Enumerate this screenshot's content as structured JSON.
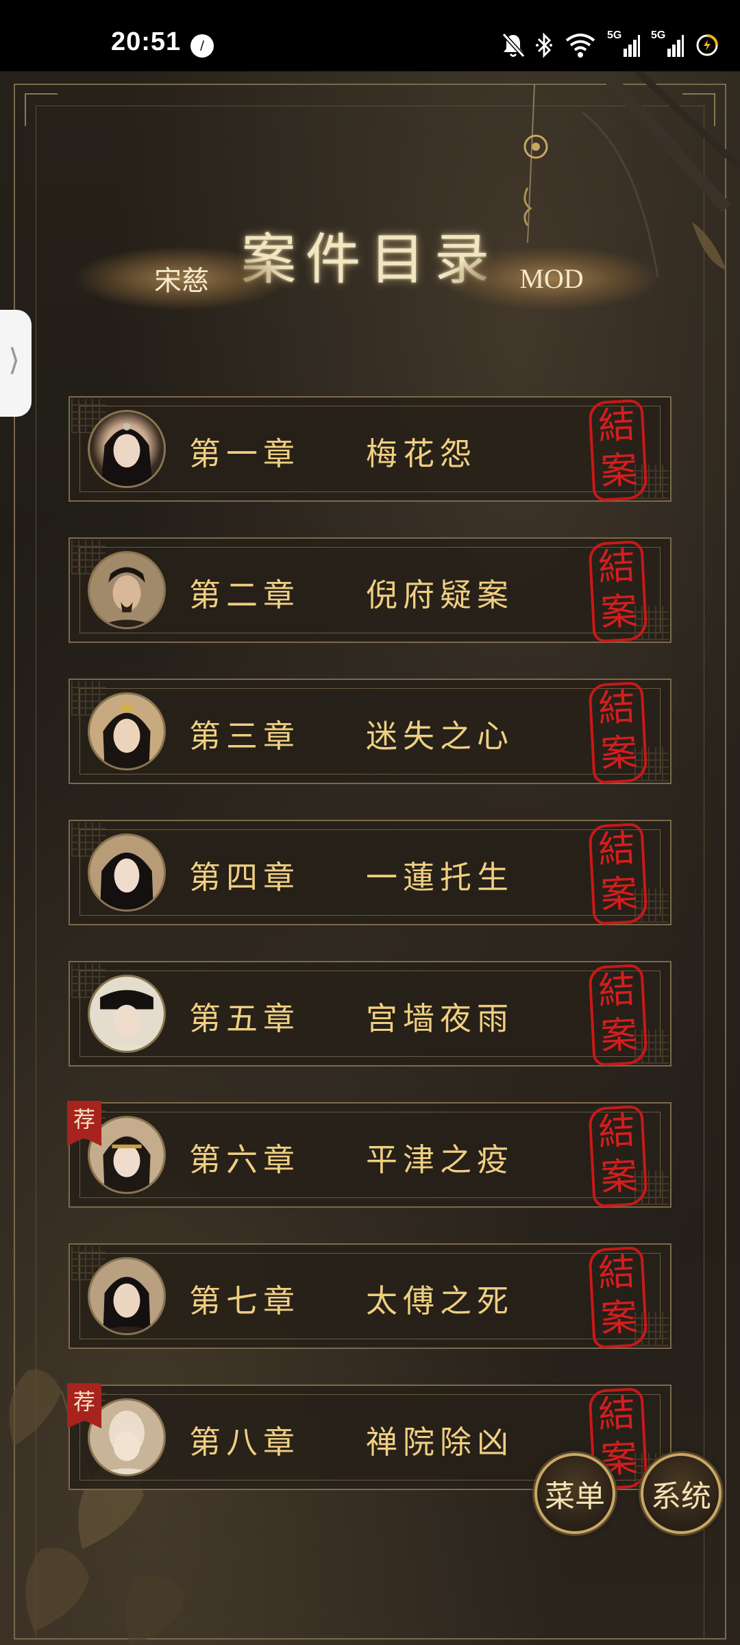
{
  "status_bar": {
    "time": "20:51",
    "app_icon_glyph": "/",
    "network_label_1": "5G",
    "network_label_2": "5G",
    "icons": [
      "mute-icon",
      "bluetooth-icon",
      "wifi-icon",
      "signal-5g-icon",
      "signal-5g-icon",
      "battery-charging-icon"
    ]
  },
  "page": {
    "title": "案件目录",
    "drawer_handle_glyph": "⟩"
  },
  "tabs": [
    {
      "label": "宋慈"
    },
    {
      "label": "MOD"
    }
  ],
  "chapters": [
    {
      "number": "第一章",
      "name": "梅花怨",
      "seal": [
        "結",
        "案"
      ],
      "recommended": false
    },
    {
      "number": "第二章",
      "name": "倪府疑案",
      "seal": [
        "結",
        "案"
      ],
      "recommended": false
    },
    {
      "number": "第三章",
      "name": "迷失之心",
      "seal": [
        "結",
        "案"
      ],
      "recommended": false
    },
    {
      "number": "第四章",
      "name": "一蓮托生",
      "seal": [
        "結",
        "案"
      ],
      "recommended": false
    },
    {
      "number": "第五章",
      "name": "宫墙夜雨",
      "seal": [
        "結",
        "案"
      ],
      "recommended": false
    },
    {
      "number": "第六章",
      "name": "平津之疫",
      "seal": [
        "結",
        "案"
      ],
      "recommended": true,
      "badge": "荐"
    },
    {
      "number": "第七章",
      "name": "太傅之死",
      "seal": [
        "結",
        "案"
      ],
      "recommended": false
    },
    {
      "number": "第八章",
      "name": "禅院除凶",
      "seal": [
        "結",
        "案"
      ],
      "recommended": true,
      "badge": "荐"
    }
  ],
  "buttons": {
    "menu": "菜单",
    "system": "系统"
  },
  "colors": {
    "gold_text": "#f0cf82",
    "seal_red": "#d41e1e",
    "frame": "#7c6a4c",
    "background": "#1e1a16"
  }
}
